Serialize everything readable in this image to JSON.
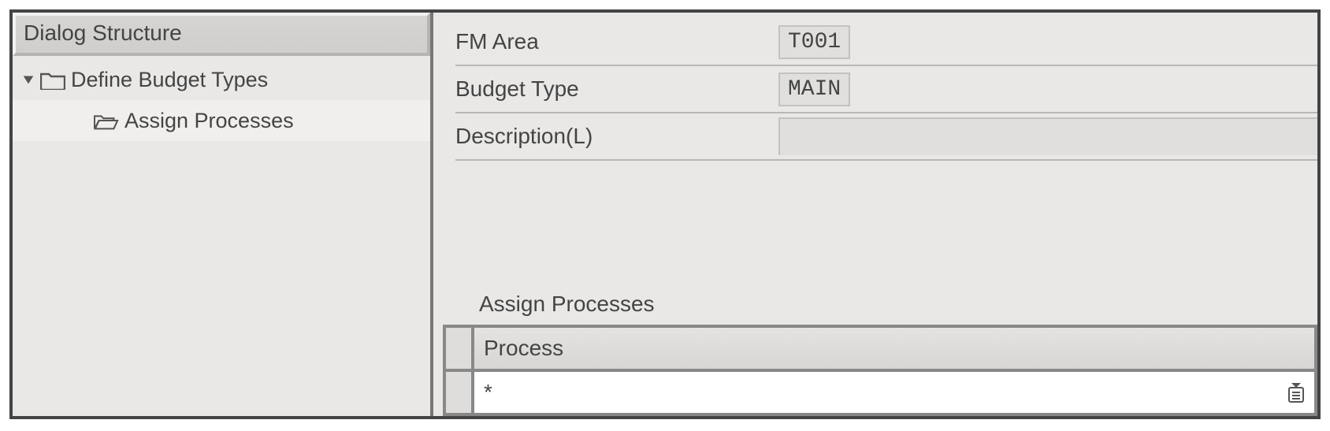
{
  "sidebar": {
    "header": "Dialog Structure",
    "items": [
      {
        "label": "Define Budget Types"
      },
      {
        "label": "Assign Processes"
      }
    ]
  },
  "fields": {
    "fm_area": {
      "label": "FM Area",
      "value": "T001"
    },
    "budget_type": {
      "label": "Budget Type",
      "value": "MAIN"
    },
    "description": {
      "label": "Description(L)",
      "value": ""
    }
  },
  "table": {
    "title": "Assign Processes",
    "column": "Process",
    "rows": [
      {
        "value": "*"
      }
    ]
  }
}
